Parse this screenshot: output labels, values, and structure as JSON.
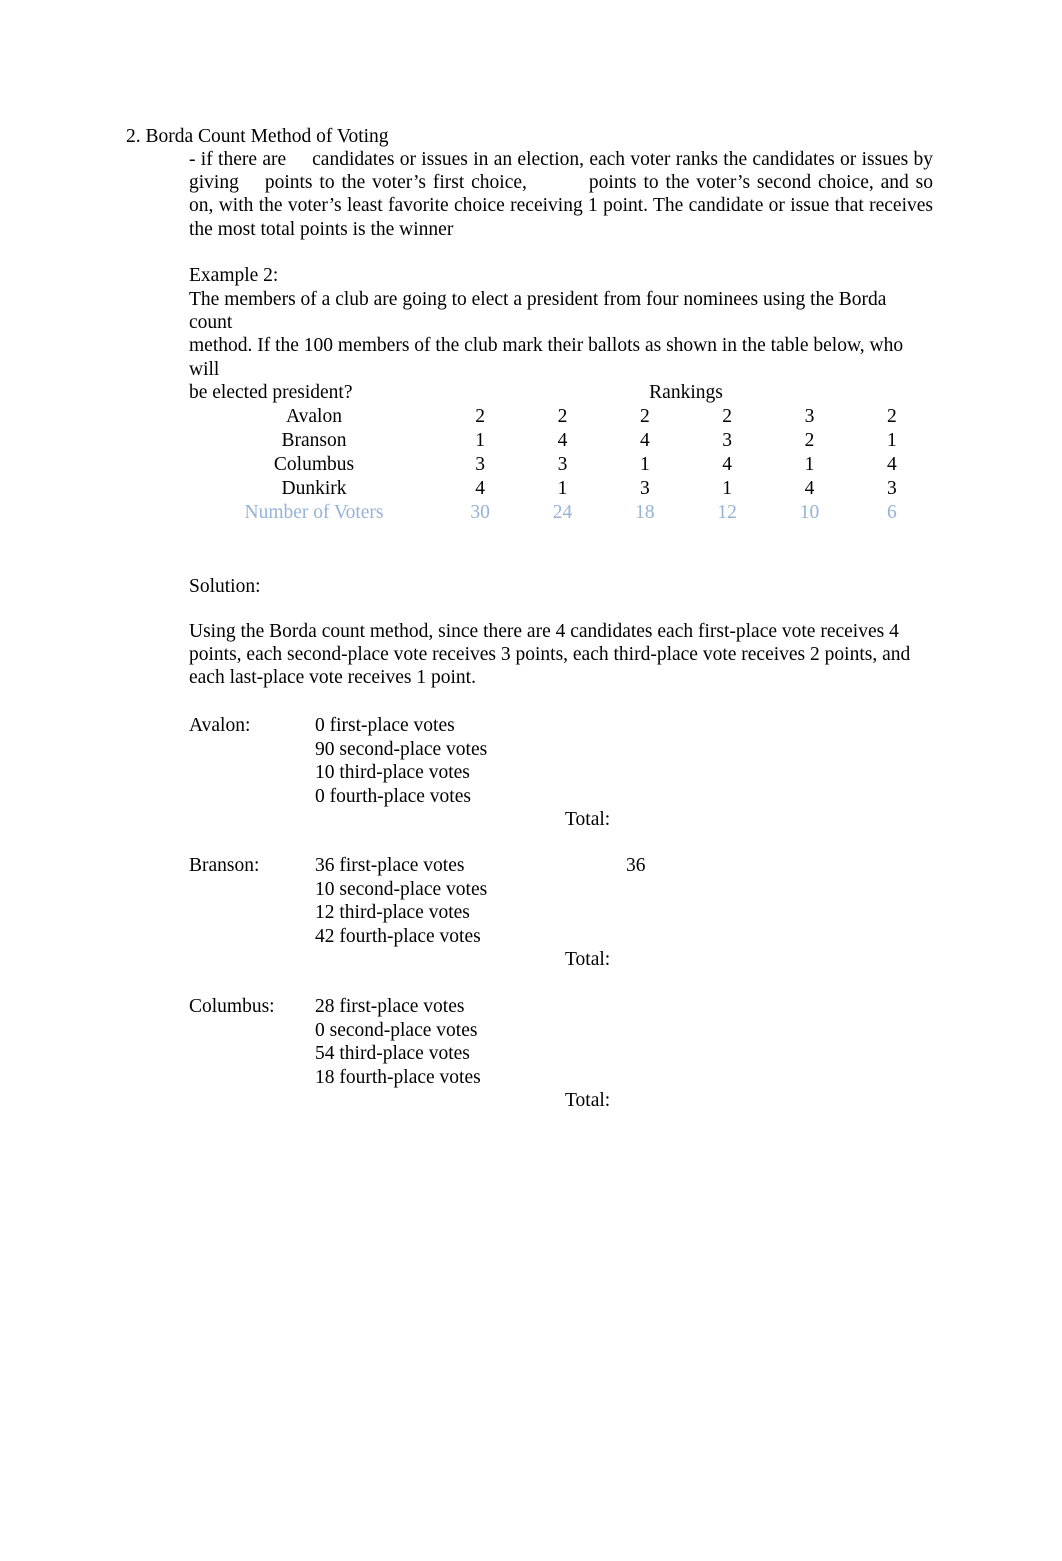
{
  "document": {
    "heading": "2. Borda Count Method of Voting",
    "definition": {
      "line1_a": "- if there are",
      "line1_b": "candidates or issues in an election, each voter ranks the candidates or issues by",
      "line2_a": "giving",
      "line2_b": "points to the voter’s first choice,",
      "line2_c": "points to the voter’s second choice, and so on,",
      "line3": "with the voter’s least favorite choice receiving 1 point. The candidate  or issue that receives the",
      "line4": "most total points is the winner"
    },
    "example": {
      "label": "Example 2:",
      "line1": "The members of a club are going to elect a president from four nominees using the Borda count",
      "line2": "method. If the 100 members of the club mark their ballots as shown in the table below, who will",
      "line3": "be elected president?"
    },
    "solution": {
      "label": "Solution:",
      "line1": "Using the Borda count method, since there are 4 candidates each first-place vote receives 4",
      "line2": "points, each second-place vote receives 3 points, each third-place vote receives 2 points, and",
      "line3": "each last-place vote receives 1 point."
    }
  },
  "ballot_table": {
    "header": "Rankings",
    "rows": [
      {
        "name": "Avalon",
        "ranks": [
          "2",
          "2",
          "2",
          "2",
          "3",
          "2"
        ]
      },
      {
        "name": "Branson",
        "ranks": [
          "1",
          "4",
          "4",
          "3",
          "2",
          "1"
        ]
      },
      {
        "name": "Columbus",
        "ranks": [
          "3",
          "3",
          "1",
          "4",
          "1",
          "4"
        ]
      },
      {
        "name": "Dunkirk",
        "ranks": [
          "4",
          "1",
          "3",
          "1",
          "4",
          "3"
        ]
      }
    ],
    "voters_label": "Number of Voters",
    "voters": [
      "30",
      "24",
      "18",
      "12",
      "10",
      "6"
    ],
    "voters_color": "#95B3D7"
  },
  "tallies": [
    {
      "label": "Avalon:",
      "lines": [
        "0 first-place votes",
        "90 second-place votes",
        "10 third-place votes",
        "0 fourth-place votes"
      ],
      "extra": "",
      "total_label": "Total:",
      "total_value": ""
    },
    {
      "label": "Branson:",
      "lines": [
        "36 first-place votes",
        "10 second-place votes",
        "12 third-place votes",
        "42 fourth-place votes"
      ],
      "extra": "36",
      "total_label": "Total:",
      "total_value": ""
    },
    {
      "label": "Columbus:",
      "lines": [
        "28 first-place votes",
        "0 second-place votes",
        "54 third-place votes",
        "18 fourth-place votes"
      ],
      "extra": "",
      "total_label": "Total:",
      "total_value": ""
    }
  ]
}
